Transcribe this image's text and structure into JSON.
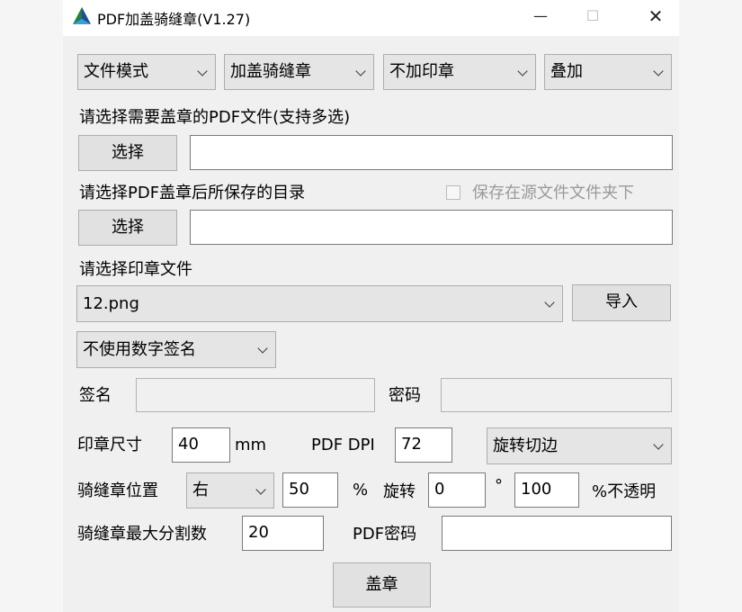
{
  "window": {
    "title": "PDF加盖骑缝章(V1.27)",
    "minimize": "—",
    "maximize": "☐",
    "close": "✕"
  },
  "toolbar": {
    "mode": "文件模式",
    "action": "加盖骑缝章",
    "stamp_option": "不加印章",
    "overlay": "叠加"
  },
  "pdf_select": {
    "label": "请选择需要盖章的PDF文件(支持多选)",
    "button": "选择",
    "value": ""
  },
  "output_dir": {
    "label": "请选择PDF盖章后所保存的目录",
    "button": "选择",
    "value": "",
    "save_in_source_label": "保存在源文件文件夹下"
  },
  "stamp_file": {
    "label": "请选择印章文件",
    "value": "12.png",
    "import_button": "导入"
  },
  "signature": {
    "option": "不使用数字签名",
    "sign_label": "签名",
    "sign_value": "",
    "password_label": "密码",
    "password_value": ""
  },
  "size_row": {
    "label": "印章尺寸",
    "value": "40",
    "unit": "mm",
    "dpi_label": "PDF DPI",
    "dpi_value": "72",
    "rotate_option": "旋转切边"
  },
  "position_row": {
    "label": "骑缝章位置",
    "position": "右",
    "percent_value": "50",
    "percent_unit": "%",
    "rotate_label": "旋转",
    "rotate_value": "0",
    "degree_unit": "°",
    "opacity_value": "100",
    "opacity_unit": "%不透明"
  },
  "split_row": {
    "label": "骑缝章最大分割数",
    "value": "20",
    "pdf_password_label": "PDF密码",
    "pdf_password_value": ""
  },
  "stamp_button": "盖章"
}
